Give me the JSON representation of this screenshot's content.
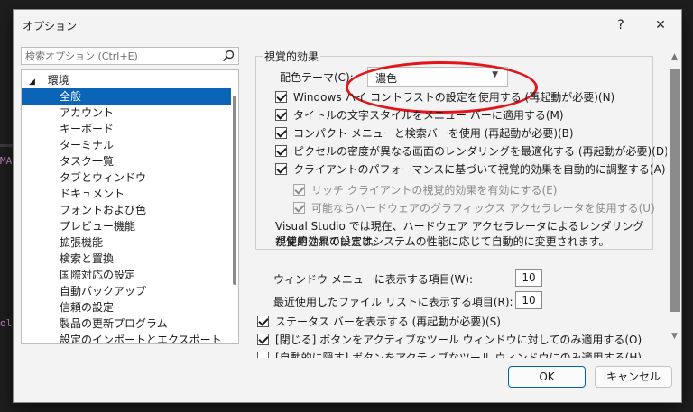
{
  "dialog": {
    "title": "オプション",
    "help_label": "?",
    "close_label": "✕"
  },
  "search": {
    "placeholder": "検索オプション (Ctrl+E)"
  },
  "tree": {
    "root": "環境",
    "items": [
      "全般",
      "アカウント",
      "キーボード",
      "ターミナル",
      "タスク一覧",
      "タブとウィンドウ",
      "ドキュメント",
      "フォントおよび色",
      "プレビュー機能",
      "拡張機能",
      "検索と置換",
      "国際対応の設定",
      "自動バックアップ",
      "信頼の設定",
      "製品の更新プログラム",
      "設定のインポートとエクスポート"
    ],
    "selected": "全般"
  },
  "visual": {
    "group_label": "視覚的効果",
    "color_theme_label": "配色テーマ(C):",
    "color_theme_value": "濃色",
    "options": [
      {
        "label": "Windows ハイ コントラストの設定を使用する (再起動が必要)(N)",
        "checked": true
      },
      {
        "label": "タイトルの文字スタイルをメニュー バーに適用する(M)",
        "checked": true
      },
      {
        "label": "コンパクト メニューと検索バーを使用 (再起動が必要)(B)",
        "checked": true
      },
      {
        "label": "ピクセルの密度が異なる画面のレンダリングを最適化する (再起動が必要)(D)",
        "checked": true
      },
      {
        "label": "クライアントのパフォーマンスに基づいて視覚的効果を自動的に調整する(A)",
        "checked": true
      }
    ],
    "sub_options": [
      {
        "label": "リッチ クライアントの視覚的効果を有効にする(E)",
        "checked": true
      },
      {
        "label": "可能ならハードウェアのグラフィックス アクセラレータを使用する(U)",
        "checked": true
      }
    ],
    "info_line1": "Visual Studio では現在、ハードウェア アクセラレータによるレンダリングが使用されています。",
    "info_line2": "視覚的効果の設定はシステムの性能に応じて自動的に変更されます。"
  },
  "window_menu": {
    "label": "ウィンドウ メニューに表示する項目(W):",
    "value": "10"
  },
  "recent_files": {
    "label": "最近使用したファイル リストに表示する項目(R):",
    "value": "10"
  },
  "bottom_options": [
    {
      "label": "ステータス バーを表示する (再起動が必要)(S)",
      "checked": true
    },
    {
      "label": "[閉じる] ボタンをアクティブなツール ウィンドウに対してのみ適用する(O)",
      "checked": true
    },
    {
      "label": "[自動的に隠す] ボタンをアクティブなツール ウィンドウにのみ適用する(H)",
      "checked": false
    }
  ],
  "buttons": {
    "ok": "OK",
    "cancel": "キャンセル"
  },
  "background": {
    "text1": "MA",
    "text2": "ol"
  }
}
